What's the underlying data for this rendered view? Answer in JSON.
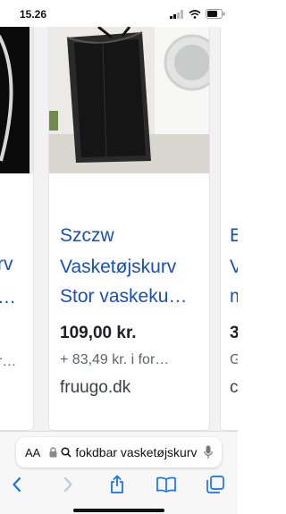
{
  "status_bar": {
    "time": "15.26"
  },
  "cards": {
    "left": {
      "title_lines": [
        "rv",
        "…"
      ],
      "shipping": "r…",
      "store": ""
    },
    "center": {
      "title_lines": [
        "Szczw",
        "Vasketøjskurv",
        "Stor vaskeku…"
      ],
      "price": "109,00 kr.",
      "shipping": "+ 83,49 kr. i for…",
      "store": "fruugo.dk"
    },
    "right": {
      "title_lines": [
        "E",
        "V",
        "m"
      ],
      "price": "3",
      "shipping": "G",
      "store": "c"
    }
  },
  "address_bar": {
    "aa_label": "AA",
    "url": "fokdbar vasketøjskurv"
  },
  "icons": {
    "back": "chevron-left-icon",
    "forward": "chevron-right-icon",
    "share": "share-icon",
    "bookmarks": "book-icon",
    "tabs": "tabs-icon",
    "lock": "lock-icon",
    "mic": "microphone-icon"
  },
  "colors": {
    "link_blue": "#1a4fb5",
    "ios_blue": "#1a73e8"
  }
}
